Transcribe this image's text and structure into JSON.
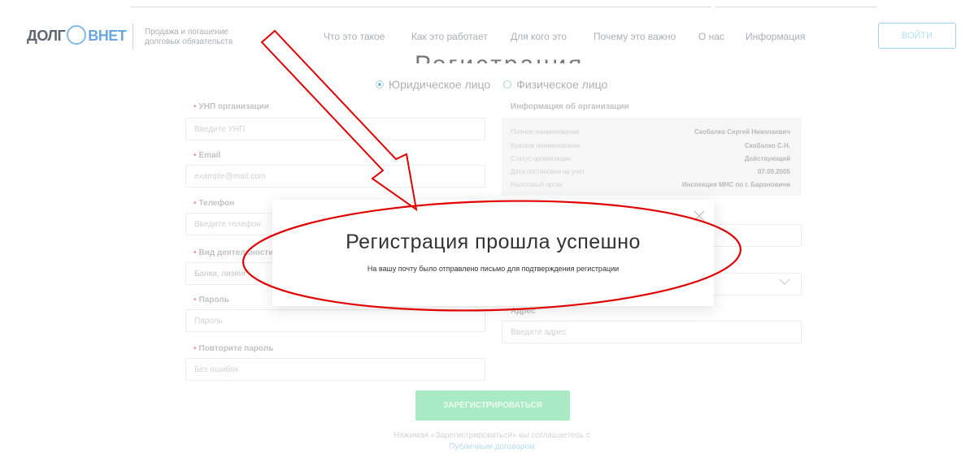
{
  "header": {
    "logo_left": "ДОЛГ",
    "logo_right": "ВНЕТ",
    "tagline": "Продажа и погашение долговых обязательств",
    "nav": [
      "Что это такое",
      "Как это работает",
      "Для кого это",
      "Почему это важно",
      "О нас",
      "Информация"
    ],
    "login_label": "ВОЙТИ"
  },
  "form": {
    "title": "Регистрация",
    "radio_legal": "Юридическое лицо",
    "radio_physical": "Физическое лицо",
    "unp_label": "УНП организации",
    "unp_placeholder": "Введите УНП",
    "email_label": "Email",
    "email_placeholder": "example@mail.com",
    "phone_label": "Телефон",
    "phone_placeholder": "Введите телефон",
    "activity_label": "Вид деятельности",
    "activity_value": "Банки, лизинг",
    "password_label": "Пароль",
    "password_placeholder": "Пароль",
    "password2_label": "Повторите пароль",
    "password2_placeholder": "Без ошибок",
    "address_label": "Адрес",
    "address_placeholder": "Введите адрес",
    "submit_label": "ЗАРЕГИСТРИРОВАТЬСЯ",
    "agree_text": "Нажимая «Зарегистрироваться» вы соглашаетесь с",
    "agree_link": "Публичным договором"
  },
  "org_info": {
    "title": "Информация об организации",
    "rows": [
      {
        "key": "Полное наименование",
        "value": "Скобалко Сергей Николаевич"
      },
      {
        "key": "Краткое наименование",
        "value": "Скобалко С.Н."
      },
      {
        "key": "Статус организации",
        "value": "Действующий"
      },
      {
        "key": "Дата постановки на учет",
        "value": "07.09.2005"
      },
      {
        "key": "Налоговый орган",
        "value": "Инспекция МНС по г. Барановичи"
      }
    ]
  },
  "modal": {
    "title": "Регистрация прошла успешно",
    "message": "На вашу почту было отправлено письмо для подтверждения регистрации"
  },
  "colors": {
    "annotation": "#e00000",
    "accent": "#7fb6e3",
    "submit": "#a8eac4"
  }
}
